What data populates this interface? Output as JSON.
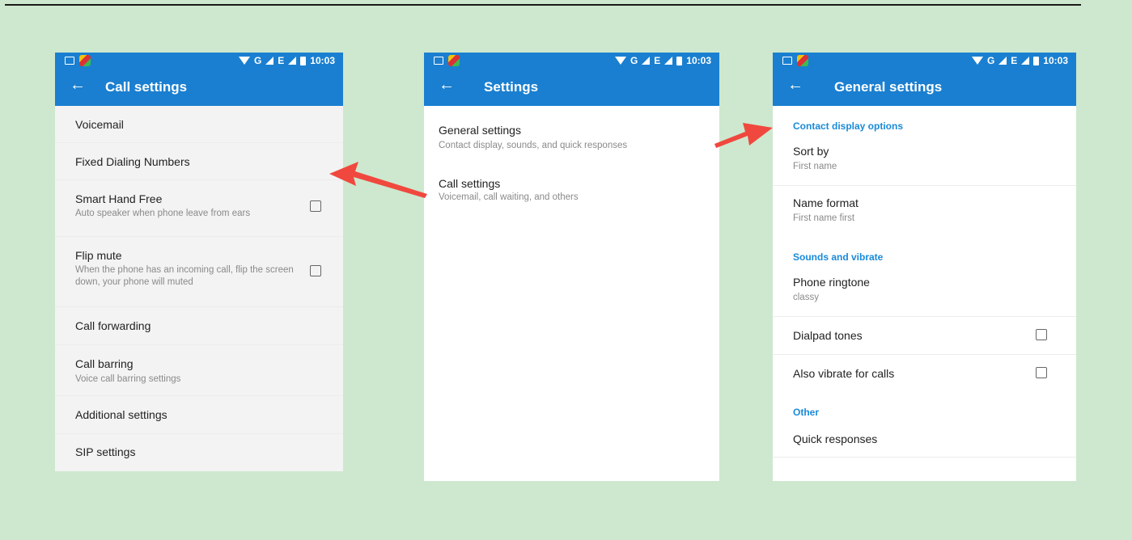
{
  "status": {
    "time": "10:03",
    "network": "G",
    "network2": "E"
  },
  "screen1": {
    "title": "Call settings",
    "items": [
      {
        "title": "Voicemail"
      },
      {
        "title": "Fixed Dialing Numbers"
      },
      {
        "title": "Smart Hand Free",
        "subtitle": "Auto speaker when phone leave from ears",
        "checkbox": false
      },
      {
        "title": "Flip mute",
        "subtitle": "When the phone has an incoming call, flip the screen down, your phone will muted",
        "checkbox": false
      },
      {
        "title": "Call forwarding"
      },
      {
        "title": "Call barring",
        "subtitle": "Voice call barring settings"
      },
      {
        "title": "Additional settings"
      },
      {
        "title": "SIP settings"
      }
    ]
  },
  "screen2": {
    "title": "Settings",
    "items": [
      {
        "title": "General settings",
        "subtitle": "Contact display, sounds, and quick responses"
      },
      {
        "title": "Call settings",
        "subtitle": "Voicemail, call waiting, and others"
      }
    ]
  },
  "screen3": {
    "title": "General settings",
    "sections": [
      "Contact display options",
      "Sounds and vibrate",
      "Other"
    ],
    "items": [
      {
        "title": "Sort by",
        "subtitle": "First name"
      },
      {
        "title": "Name format",
        "subtitle": "First name first"
      },
      {
        "title": "Phone ringtone",
        "subtitle": "classy"
      },
      {
        "title": "Dialpad tones",
        "checkbox": false
      },
      {
        "title": "Also vibrate for calls",
        "checkbox": false
      },
      {
        "title": "Quick responses"
      }
    ]
  },
  "colors": {
    "appbar": "#1a7fd0",
    "accent": "#1a8ad8",
    "arrow": "#f0483e",
    "background": "#cde8ce"
  }
}
